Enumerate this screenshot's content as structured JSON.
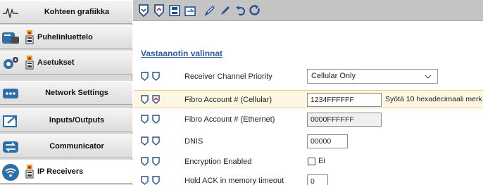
{
  "sidebar": {
    "items": [
      {
        "label": "Kohteen grafiikka",
        "icon": "waveform-icon"
      },
      {
        "label": "Puhelinluettelo",
        "icon": "phone-icon"
      },
      {
        "label": "Asetukset",
        "icon": "gear-icon"
      },
      {
        "label": "Network Settings",
        "icon": "dots-icon"
      },
      {
        "label": "Inputs/Outputs",
        "icon": "io-icon"
      },
      {
        "label": "Communicator",
        "icon": "arrows-icon"
      },
      {
        "label": "IP Receivers",
        "icon": "wifi-icon"
      }
    ],
    "active_index": 6
  },
  "toolbar": {
    "buttons": [
      "send-icon",
      "receive-icon",
      "save-icon",
      "load-icon",
      "pencil-icon",
      "pencil-icon",
      "undo-icon",
      "refresh-icon"
    ]
  },
  "section": {
    "title": "Vastaanotin valinnat"
  },
  "rows": [
    {
      "label": "Receiver Channel Priority",
      "type": "select",
      "value": "Cellular Only"
    },
    {
      "label": "Fibro Account # (Cellular)",
      "type": "text",
      "value": "1234FFFFFF",
      "hint": "Syötä 10 hexadecimaali merk"
    },
    {
      "label": "Fibro Account # (Ethernet)",
      "type": "text",
      "value": "0000FFFFFF"
    },
    {
      "label": "DNIS",
      "type": "text",
      "value": "00000"
    },
    {
      "label": "Encryption Enabled",
      "type": "checkbox",
      "value": "Ei"
    },
    {
      "label": "Hold ACK in memory timeout",
      "type": "text",
      "value": "0"
    }
  ],
  "colors": {
    "link_blue": "#2f5aa0",
    "highlight_bg": "#fdf6e3",
    "toolbar_bg": "#c4c4c4"
  }
}
